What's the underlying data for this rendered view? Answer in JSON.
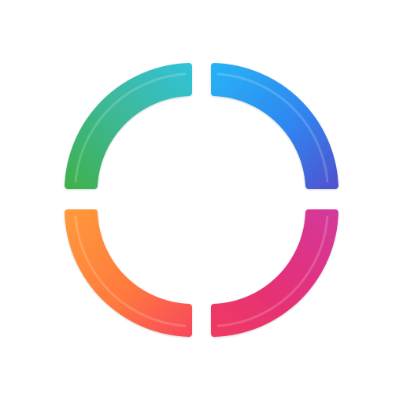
{
  "logo": {
    "name": "four-segment-ring-logo",
    "segments": [
      {
        "id": "top-left",
        "colors": [
          "#3FB14F",
          "#3DB9B5",
          "#31C2D9"
        ]
      },
      {
        "id": "top-right",
        "colors": [
          "#27B3F5",
          "#2F86F0",
          "#5150CC"
        ]
      },
      {
        "id": "bottom-right",
        "colors": [
          "#D33A9B",
          "#E3307A",
          "#F03A5F"
        ]
      },
      {
        "id": "bottom-left",
        "colors": [
          "#FF9A3A",
          "#FF7A3D",
          "#F8465D"
        ]
      }
    ]
  }
}
